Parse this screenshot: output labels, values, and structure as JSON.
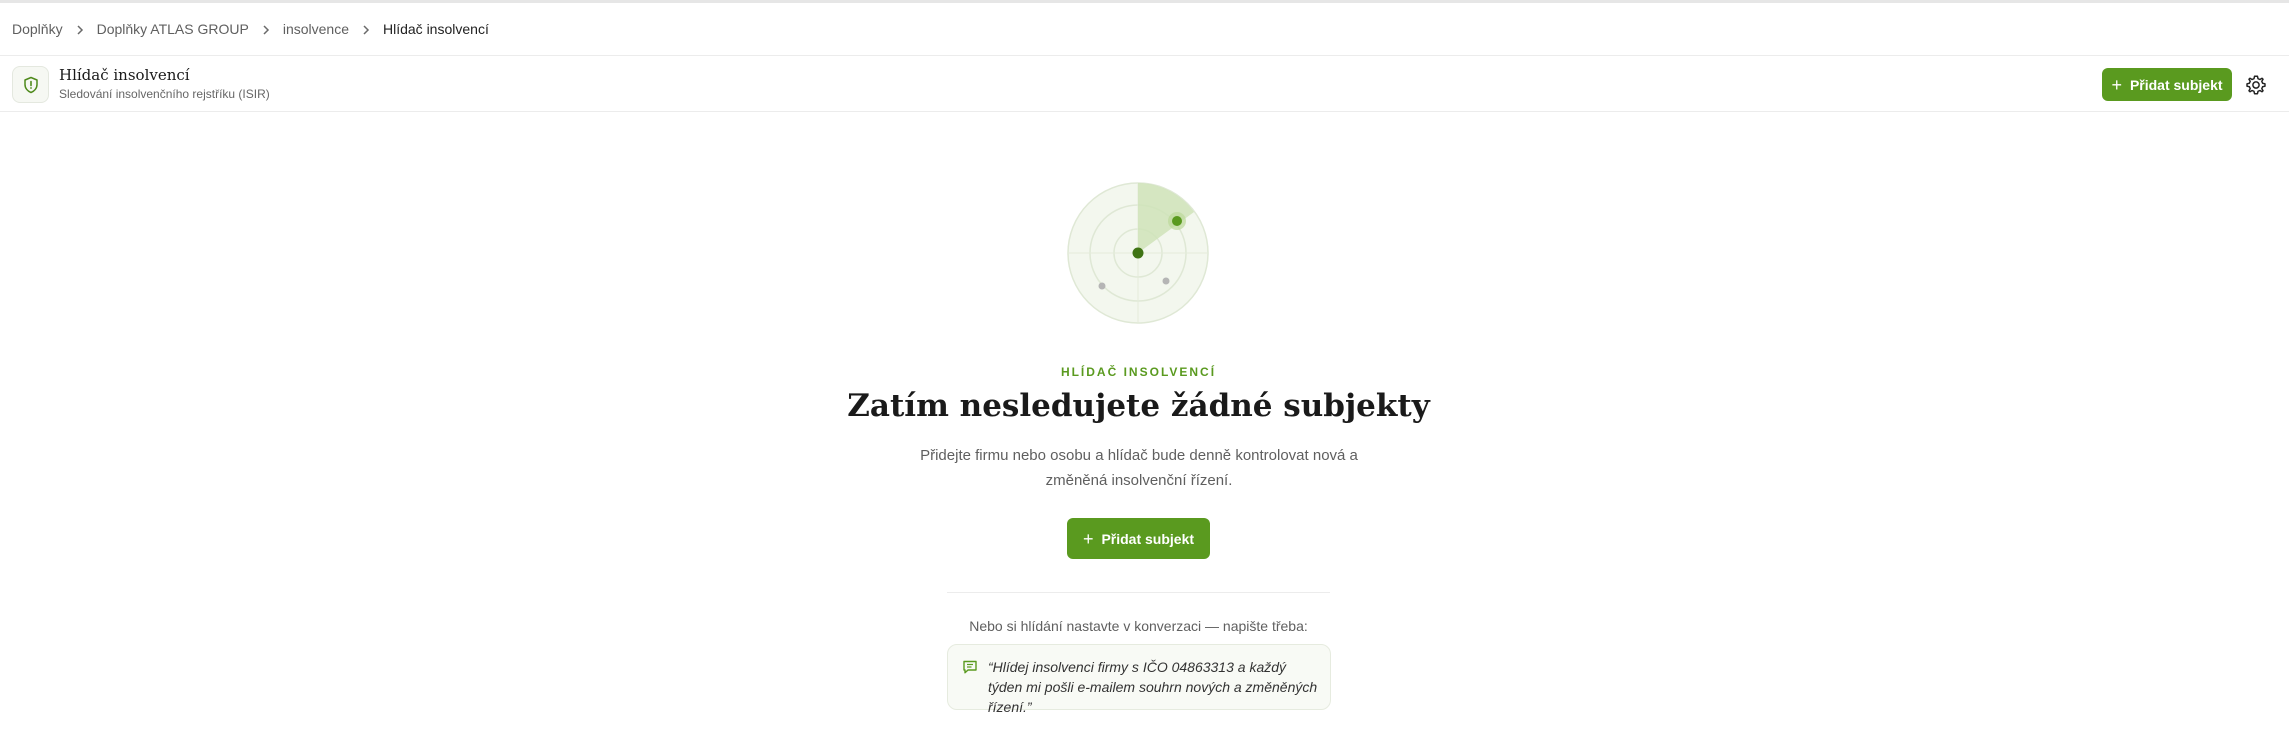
{
  "breadcrumb": {
    "items": [
      "Doplňky",
      "Doplňky ATLAS GROUP",
      "insolvence",
      "Hlídač insolvencí"
    ]
  },
  "header": {
    "icon": "shield-icon",
    "title": "Hlídač insolvencí",
    "subtitle": "Sledování insolvenčního rejstříku (ISIR)",
    "add_button_label": "Přidat subjekt",
    "settings_icon": "gear-icon"
  },
  "empty_state": {
    "illustration": "radar-icon",
    "eyebrow": "HLÍDAČ INSOLVENCÍ",
    "title": "Zatím nesledujete žádné subjekty",
    "description": "Přidejte firmu nebo osobu a hlídač bude denně kontrolovat nová a změněná insolvenční řízení.",
    "add_button_label": "Přidat subjekt",
    "hint": "Nebo si hlídání nastavte v konverzaci — napište třeba:",
    "example_icon": "chat-icon",
    "example_text": "“Hlídej insolvenci firmy s IČO 04863313 a každý týden mi pošli e-mailem souhrn nových a změněných řízení.”"
  },
  "colors": {
    "accent": "#5a9a1f",
    "accent_dark": "#3f7314",
    "radar_fill": "#f3f7ee"
  }
}
